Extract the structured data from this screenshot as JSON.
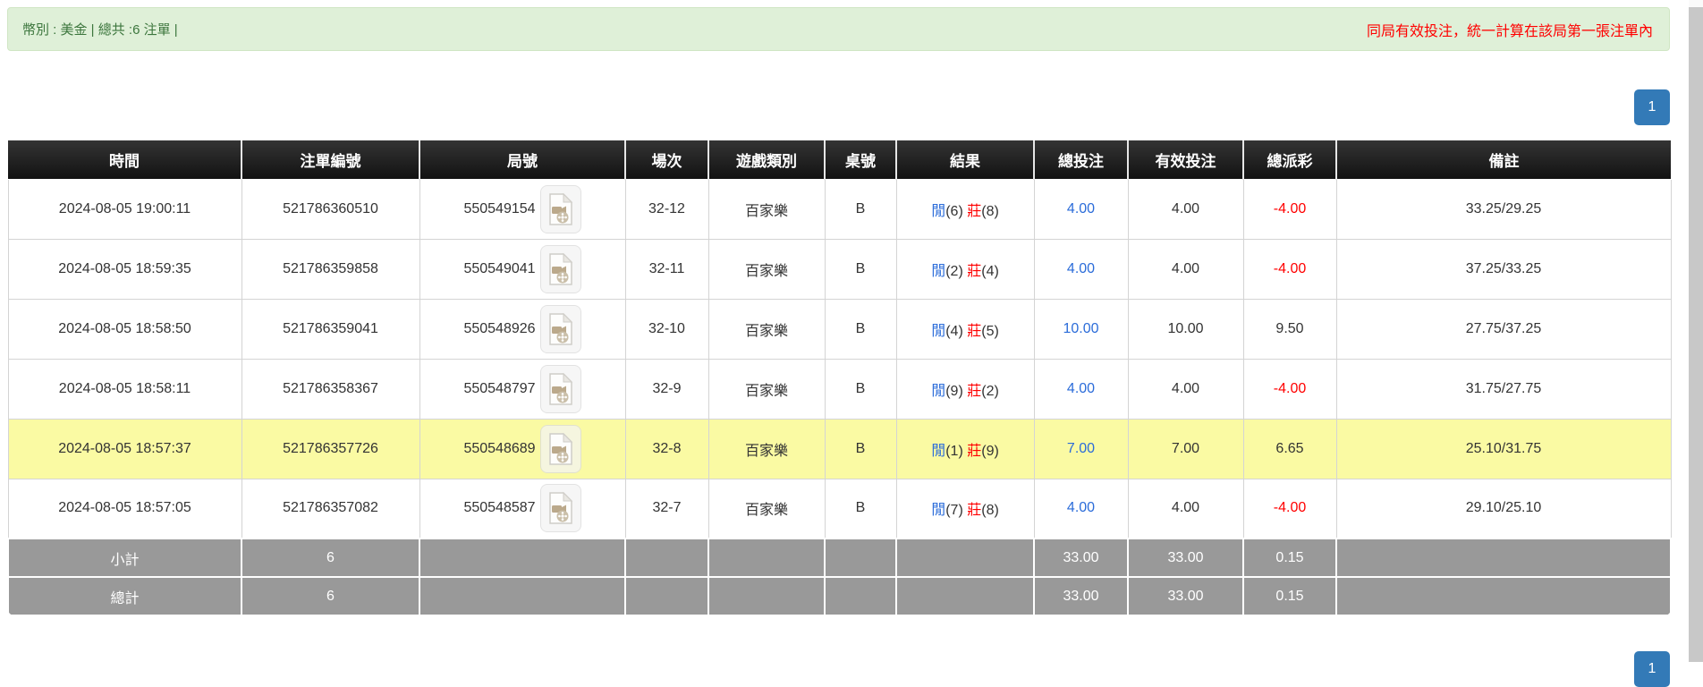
{
  "banner": {
    "left_text": "幣別 : 美金 | 總共 :6 注單 |",
    "right_text": "同局有效投注，統一計算在該局第一張注單內"
  },
  "pagination": {
    "top": "1",
    "bottom": "1"
  },
  "table": {
    "columns": [
      "時間",
      "注單編號",
      "局號",
      "場次",
      "遊戲類別",
      "桌號",
      "結果",
      "總投注",
      "有效投注",
      "總派彩",
      "備註"
    ],
    "result_labels": {
      "player": "閒",
      "banker": "莊"
    },
    "rows": [
      {
        "time": "2024-08-05 19:00:11",
        "bet_id": "521786360510",
        "round_id": "550549154",
        "session": "32-12",
        "game_type": "百家樂",
        "table_no": "B",
        "result": {
          "player": "6",
          "banker": "8"
        },
        "total_bet": "4.00",
        "valid_bet": "4.00",
        "total_payout": "-4.00",
        "remark": "33.25/29.25",
        "highlighted": false
      },
      {
        "time": "2024-08-05 18:59:35",
        "bet_id": "521786359858",
        "round_id": "550549041",
        "session": "32-11",
        "game_type": "百家樂",
        "table_no": "B",
        "result": {
          "player": "2",
          "banker": "4"
        },
        "total_bet": "4.00",
        "valid_bet": "4.00",
        "total_payout": "-4.00",
        "remark": "37.25/33.25",
        "highlighted": false
      },
      {
        "time": "2024-08-05 18:58:50",
        "bet_id": "521786359041",
        "round_id": "550548926",
        "session": "32-10",
        "game_type": "百家樂",
        "table_no": "B",
        "result": {
          "player": "4",
          "banker": "5"
        },
        "total_bet": "10.00",
        "valid_bet": "10.00",
        "total_payout": "9.50",
        "remark": "27.75/37.25",
        "highlighted": false
      },
      {
        "time": "2024-08-05 18:58:11",
        "bet_id": "521786358367",
        "round_id": "550548797",
        "session": "32-9",
        "game_type": "百家樂",
        "table_no": "B",
        "result": {
          "player": "9",
          "banker": "2"
        },
        "total_bet": "4.00",
        "valid_bet": "4.00",
        "total_payout": "-4.00",
        "remark": "31.75/27.75",
        "highlighted": false
      },
      {
        "time": "2024-08-05 18:57:37",
        "bet_id": "521786357726",
        "round_id": "550548689",
        "session": "32-8",
        "game_type": "百家樂",
        "table_no": "B",
        "result": {
          "player": "1",
          "banker": "9"
        },
        "total_bet": "7.00",
        "valid_bet": "7.00",
        "total_payout": "6.65",
        "remark": "25.10/31.75",
        "highlighted": true
      },
      {
        "time": "2024-08-05 18:57:05",
        "bet_id": "521786357082",
        "round_id": "550548587",
        "session": "32-7",
        "game_type": "百家樂",
        "table_no": "B",
        "result": {
          "player": "7",
          "banker": "8"
        },
        "total_bet": "4.00",
        "valid_bet": "4.00",
        "total_payout": "-4.00",
        "remark": "29.10/25.10",
        "highlighted": false
      }
    ],
    "subtotal": {
      "label": "小計",
      "count": "6",
      "total_bet": "33.00",
      "valid_bet": "33.00",
      "total_payout": "0.15"
    },
    "grand_total": {
      "label": "總計",
      "count": "6",
      "total_bet": "33.00",
      "valid_bet": "33.00",
      "total_payout": "0.15"
    }
  },
  "colors": {
    "banner-bg": "#dff0d8",
    "banner-border": "#d0e6c4",
    "banner-text": "#3c763d",
    "notice-red": "#ff0000",
    "amount-blue": "#2b6cd9",
    "pager-blue": "#337ab7",
    "highlight-yellow": "#fafaa3",
    "footer-gray": "#999999"
  }
}
